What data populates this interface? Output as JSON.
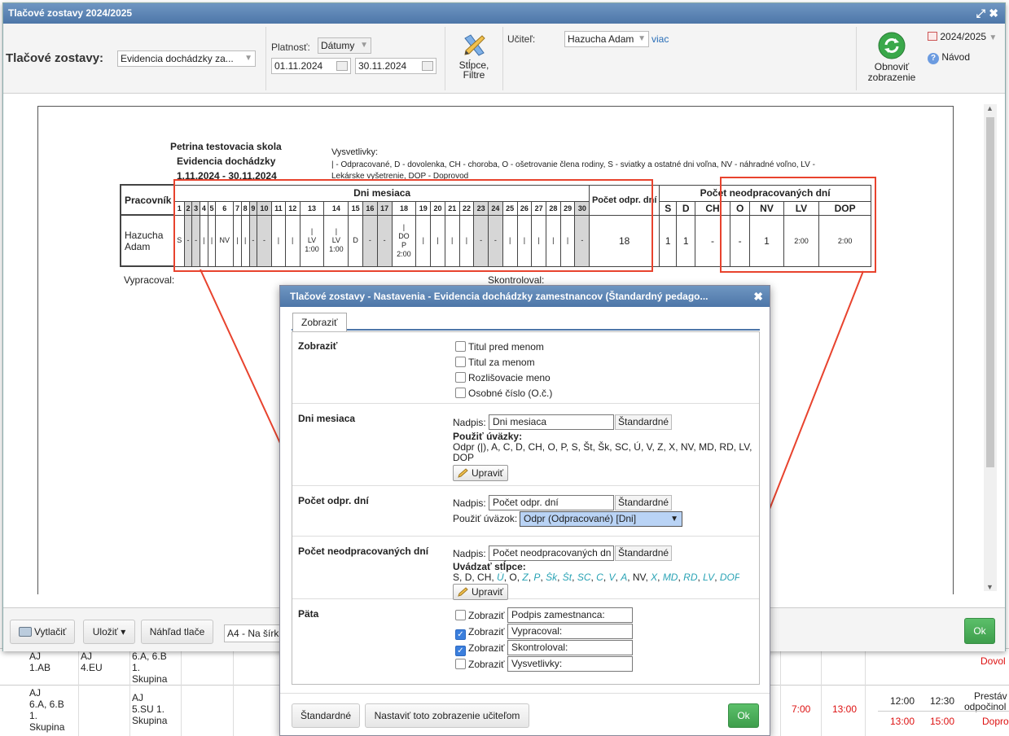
{
  "background_rows": [
    {
      "c1": "AJ\n1.AB",
      "c2": "AJ\n4.EU",
      "c3": "6.A, 6.B\n1.\nSkupina",
      "right": "Dovol"
    },
    {
      "c1": "AJ\n6.A, 6.B\n1.\nSkupina",
      "c2": "",
      "c3": "AJ\n5.SU 1.\nSkupina",
      "t1": "7:00",
      "t2": "13:00",
      "t3": "12:00",
      "t4": "12:30",
      "t5": "13:00",
      "t6": "15:00",
      "r1": "Prestáv",
      "r2": "odpočinol",
      "r3": "Dopro"
    }
  ],
  "window": {
    "title": "Tlačové zostavy 2024/2025",
    "expand_icon": "⤢",
    "close_icon": "✖"
  },
  "toolbar": {
    "label": "Tlačové zostavy:",
    "report_select": "Evidencia dochádzky za...",
    "validity_label": "Platnosť:",
    "validity_select": "Dátumy",
    "date_from": "01.11.2024",
    "date_to": "30.11.2024",
    "filters_label_1": "Stĺpce,",
    "filters_label_2": "Filtre",
    "teacher_label": "Učiteľ:",
    "teacher_select": "Hazucha Adam",
    "more_link": "viac",
    "refresh_label_1": "Obnoviť",
    "refresh_label_2": "zobrazenie",
    "year": "2024/2025",
    "help": "Návod"
  },
  "report": {
    "school": "Petrina testovacia skola",
    "title": "Evidencia dochádzky",
    "period": "1.11.2024 - 30.11.2024",
    "legend_title": "Vysvetlivky:",
    "legend_text_1": "| - Odpracované, D - dovolenka, CH - choroba, O - ošetrovanie člena rodiny, S - sviatky a ostatné dni voľna, NV - náhradné voľno, LV -",
    "legend_text_2": "Lekárske vyšetrenie, DOP - Doprovod",
    "col_worker": "Pracovník",
    "days_header": "Dni mesiaca",
    "days": [
      "1",
      "2",
      "3",
      "4",
      "5",
      "6",
      "7",
      "8",
      "9",
      "10",
      "11",
      "12",
      "13",
      "14",
      "15",
      "16",
      "17",
      "18",
      "19",
      "20",
      "21",
      "22",
      "23",
      "24",
      "25",
      "26",
      "27",
      "28",
      "29",
      "30"
    ],
    "gray_days": [
      2,
      3,
      9,
      10,
      16,
      17,
      23,
      24,
      30
    ],
    "worker": "Hazucha Adam",
    "day_values": [
      "S",
      "-",
      "-",
      "|",
      "|",
      "NV",
      "|",
      "|",
      "-",
      "-",
      "|",
      "|",
      "|\nLV\n1:00",
      "|\nLV\n1:00",
      "D",
      "-",
      "-",
      "|\nDO\nP\n2:00",
      "|",
      "|",
      "|",
      "|",
      "-",
      "-",
      "|",
      "|",
      "|",
      "|",
      "|",
      "-"
    ],
    "count_header": "Počet odpr. dní",
    "count_value": "18",
    "absence_header": "Počet neodpracovaných dní",
    "absence_cols": [
      "S",
      "D",
      "CH",
      "O",
      "NV",
      "LV",
      "DOP"
    ],
    "absence_values": [
      "1",
      "1",
      "-",
      "-",
      "1",
      "2:00",
      "2:00"
    ],
    "prepared_by": "Vypracoval:",
    "checked_by": "Skontroloval:"
  },
  "footer": {
    "print": "Vytlačiť",
    "save": "Uložiť ▾",
    "preview": "Náhľad tlače",
    "paper_select": "A4 - Na šírku",
    "ok": "Ok"
  },
  "dialog": {
    "title": "Tlačové zostavy - Nastavenia - Evidencia dochádzky zamestnancov (Štandardný pedago...",
    "close_icon": "✖",
    "tab": "Zobraziť",
    "show": {
      "title": "Zobraziť",
      "options": [
        {
          "label": "Titul pred menom",
          "checked": false
        },
        {
          "label": "Titul za menom",
          "checked": false
        },
        {
          "label": "Rozlišovacie meno",
          "checked": false
        },
        {
          "label": "Osobné číslo (O.č.)",
          "checked": false
        }
      ]
    },
    "days": {
      "title": "Dni mesiaca",
      "caption_label": "Nadpis:",
      "caption_value": "Dni mesiaca",
      "standard": "Štandardné",
      "use_label": "Použiť úväzky:",
      "use_text_1": "Odpr (|), A, C, D, CH, O, P, S, Št, Šk, SC, Ú, V, Z, X, NV, MD, RD, LV,",
      "use_text_2": "DOP",
      "edit": "Upraviť"
    },
    "count": {
      "title": "Počet odpr. dní",
      "caption_label": "Nadpis:",
      "caption_value": "Počet odpr. dní",
      "standard": "Štandardné",
      "use_label": "Použiť úväzok:",
      "use_select": "Odpr (Odpracované) [Dni]"
    },
    "absent": {
      "title": "Počet neodpracovaných dní",
      "caption_label": "Nadpis:",
      "caption_value": "Počet neodpracovaných dn",
      "standard": "Štandardné",
      "cols_label": "Uvádzať stĺpce:",
      "cols": [
        {
          "t": "S",
          "it": false
        },
        {
          "t": "D",
          "it": false
        },
        {
          "t": "CH",
          "it": false
        },
        {
          "t": "Ú",
          "it": true
        },
        {
          "t": "O",
          "it": false
        },
        {
          "t": "Z",
          "it": true
        },
        {
          "t": "P",
          "it": true
        },
        {
          "t": "Šk",
          "it": true
        },
        {
          "t": "Št",
          "it": true
        },
        {
          "t": "SC",
          "it": true
        },
        {
          "t": "C",
          "it": true
        },
        {
          "t": "V",
          "it": true
        },
        {
          "t": "A",
          "it": true
        },
        {
          "t": "NV",
          "it": false
        },
        {
          "t": "X",
          "it": true
        },
        {
          "t": "MD",
          "it": true
        },
        {
          "t": "RD",
          "it": true
        },
        {
          "t": "LV",
          "it": true
        },
        {
          "t": "DOP",
          "it": true
        }
      ],
      "edit": "Upraviť"
    },
    "footer_sec": {
      "title": "Päta",
      "rows": [
        {
          "label": "Zobraziť",
          "checked": false,
          "value": "Podpis zamestnanca:"
        },
        {
          "label": "Zobraziť",
          "checked": true,
          "value": "Vypracoval:"
        },
        {
          "label": "Zobraziť",
          "checked": true,
          "value": "Skontroloval:"
        },
        {
          "label": "Zobraziť",
          "checked": false,
          "value": "Vysvetlivky:"
        }
      ]
    },
    "btn_standard": "Štandardné",
    "btn_teachers": "Nastaviť toto zobrazenie učiteľom",
    "btn_ok": "Ok"
  },
  "colors": {
    "accent": "#4d76a8",
    "highlight": "#e8432e",
    "ok_green": "#4caf50",
    "link": "#2a6fb8",
    "italic_cyan": "#2aa3b5"
  }
}
